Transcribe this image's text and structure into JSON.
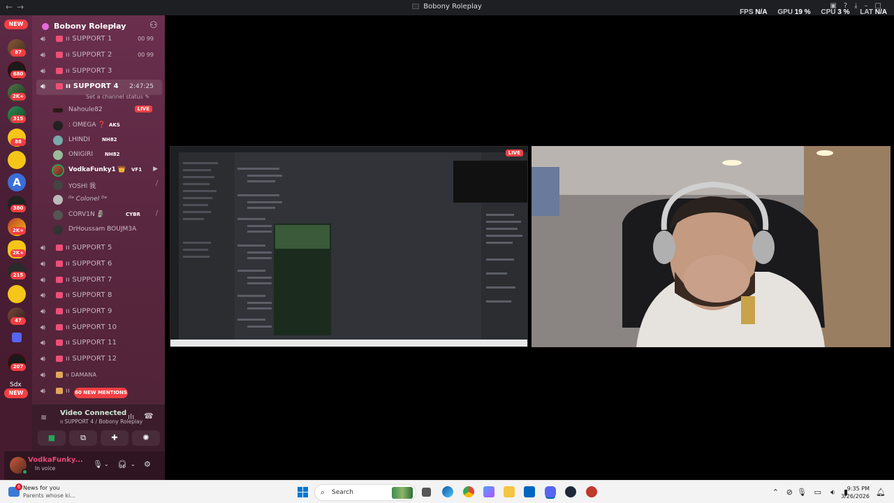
{
  "window": {
    "title": "Bobony Roleplay",
    "nav_back": "←",
    "nav_forward": "→"
  },
  "perf": {
    "fps_label": "FPS",
    "fps_value": "N/A",
    "gpu_label": "GPU",
    "gpu_value": "19 %",
    "cpu_label": "CPU",
    "cpu_value": "3 %",
    "lat_label": "LAT",
    "lat_value": "N/A"
  },
  "rail": {
    "new_top": "NEW",
    "new_bottom": "NEW",
    "badges": [
      "87",
      "680",
      "2K+",
      "315",
      "88",
      "380",
      "2K+",
      "2K+",
      "215",
      "47",
      "207"
    ],
    "sdx_label": "Sdx",
    "a_label": "A"
  },
  "server": {
    "name": "Bobony Roleplay",
    "chevron": "⌄"
  },
  "channels": {
    "support1": {
      "label": "ıı SUPPORT 1",
      "limit": "00   99"
    },
    "support2": {
      "label": "ıı SUPPORT 2",
      "limit": "00   99"
    },
    "support3": {
      "label": "ıı SUPPORT 3"
    },
    "support4": {
      "label": "ıı SUPPORT 4",
      "timer": "2:47:25",
      "status": "Set a channel status ✎"
    },
    "support5": {
      "label": "ıı SUPPORT 5"
    },
    "support6": {
      "label": "ıı SUPPORT 6"
    },
    "support7": {
      "label": "ıı SUPPORT 7"
    },
    "support8": {
      "label": "ıı SUPPORT 8"
    },
    "support9": {
      "label": "ıı SUPPORT 9"
    },
    "support10": {
      "label": "ıı SUPPORT 10"
    },
    "support11": {
      "label": "ıı SUPPORT 11"
    },
    "support12": {
      "label": "ıı SUPPORT 12"
    },
    "damana": {
      "label": "ıı DAMANA"
    },
    "last": {
      "label": "ıı"
    }
  },
  "voice_users": [
    {
      "name": "Nahoule82",
      "tag": "",
      "live": "LIVE"
    },
    {
      "name": "꞉ OMEGA ❓",
      "tag": "AKS"
    },
    {
      "name": "LHINDI",
      "tag": "NH82"
    },
    {
      "name": "ONIGIRI",
      "tag": "NH82"
    },
    {
      "name": "VodkaFunky1 👑",
      "tag": "VF1"
    },
    {
      "name": "YOSHI 我",
      "tag": ""
    },
    {
      "name": "ᴰᵃ Colonel ᴰᵃ",
      "tag": ""
    },
    {
      "name": "CORV1N 🗿",
      "tag": "CYBR"
    },
    {
      "name": "DrHoussam BOUJM3A",
      "tag": ""
    }
  ],
  "mentions": "60 NEW MENTIONS",
  "voice": {
    "status": "Video Connected",
    "channel": "ıı SUPPORT 4 / Bobony Roleplay"
  },
  "user": {
    "name": "VodkaFunky...",
    "status": "In voice"
  },
  "stream": {
    "live": "LIVE",
    "inner_title": "Bobony Roleplay",
    "inner_server": "Bobony Roleplay"
  },
  "taskbar": {
    "news_title": "News for you",
    "news_sub": "Parents whose ki...",
    "news_badge": "6",
    "search": "Search",
    "time": "9:35 PM",
    "date": "3/26/2026"
  },
  "colors": {
    "accent_red": "#f23f43",
    "live_red": "#ed4245",
    "sidebar": "#6a2f4d",
    "taskbar": "#f3f3f3",
    "voice_green": "#23a55a"
  }
}
